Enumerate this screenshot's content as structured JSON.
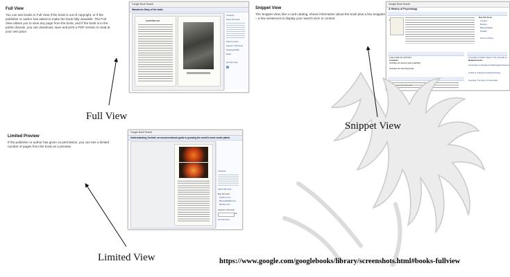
{
  "sections": {
    "full_view": {
      "title": "Full View",
      "description": "You can see books in Full View if the book is out of copyright, or if the publisher or author has asked to make the book fully viewable. The Full View allows you to view any page from the book, and if the book is in the public domain, you can download, save and print a PDF version to read at your own pace."
    },
    "snippet_view": {
      "title": "Snippet View",
      "description": "The Snippet View, like a card catalog, shows information about the book plus a few snippets – a few sentences to display your search term in context."
    },
    "limited_preview": {
      "title": "Limited Preview",
      "description": "If the publisher or author has given us permission, you can see a limited number of pages from the book as a preview."
    }
  },
  "labels": {
    "full_view": "Full View",
    "snippet_view": "Snippet View",
    "limited_view": "Limited View"
  },
  "source_url": "https://www.google.com/googlebooks/library/screenshots.html#books-fullview",
  "screens": {
    "full": {
      "search_bar": "Google  Book Search",
      "title_bar": "Wanderers Diary of the trails",
      "page_heading": "CHAPTER XVI",
      "side_items": [
        "Contents",
        "About this book",
        "Shop for book",
        "Search in this book",
        "Download PDF",
        "Read",
        "Get this book"
      ]
    },
    "snippet": {
      "search_bar": "Google  Book Search",
      "title": "A History of Psychology",
      "summary_label": "Summary",
      "contents_label": "Contents",
      "related_label": "Related books",
      "references_label": "References from books",
      "contents_rows": [
        "THE CODE OF HISTORY",
        "STAGES OF MAGIC AND ANIMISM",
        "STAGES OF RATIONALISM"
      ],
      "related_rows": [
        "Thorndike to Public Opinion: The Journals of...",
        "Introduction to Mental and Pathological Science",
        "A History of Experimental Psychology",
        "Counting: The Story of Chemicals"
      ],
      "side_items": [
        "Buy this book",
        "Amazon",
        "Borders",
        "Barnes&Noble",
        "Powells",
        "Find in a library"
      ]
    },
    "limited": {
      "search_bar": "Google  Book Search",
      "title_bar": "Understanding Orchids: an unconventional guide to growing the world's most exotic plants",
      "side_items": [
        "Contents",
        "About this book",
        "Buy this book",
        "Amazon.com",
        "Barnes&Noble.com",
        "Borders.com",
        "Search in this book",
        "Get this book",
        "Go"
      ]
    }
  }
}
